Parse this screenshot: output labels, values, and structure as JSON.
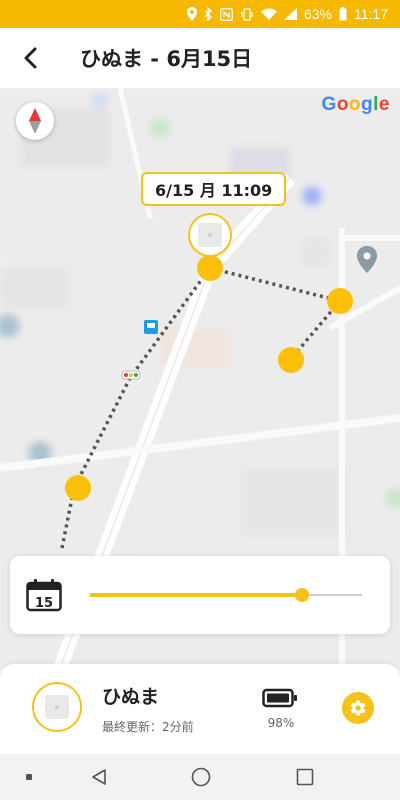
{
  "status": {
    "battery": "63%",
    "time": "11:17"
  },
  "header": {
    "title": "ひぬま - 6月15日"
  },
  "map": {
    "google_label": "Google",
    "time_label": "6/15 月 11:09"
  },
  "timeline": {
    "calendar_day": "15",
    "position": 0.78
  },
  "pet": {
    "name": "ひぬま",
    "last_updated": "最終更新：2分前",
    "battery": "98%"
  },
  "colors": {
    "accent": "#f6c21a",
    "status_bar": "#f6b800"
  },
  "icons": {
    "back": "arrow-left-icon",
    "compass": "compass-icon",
    "calendar": "calendar-icon",
    "battery": "battery-icon",
    "settings": "gear-icon"
  }
}
